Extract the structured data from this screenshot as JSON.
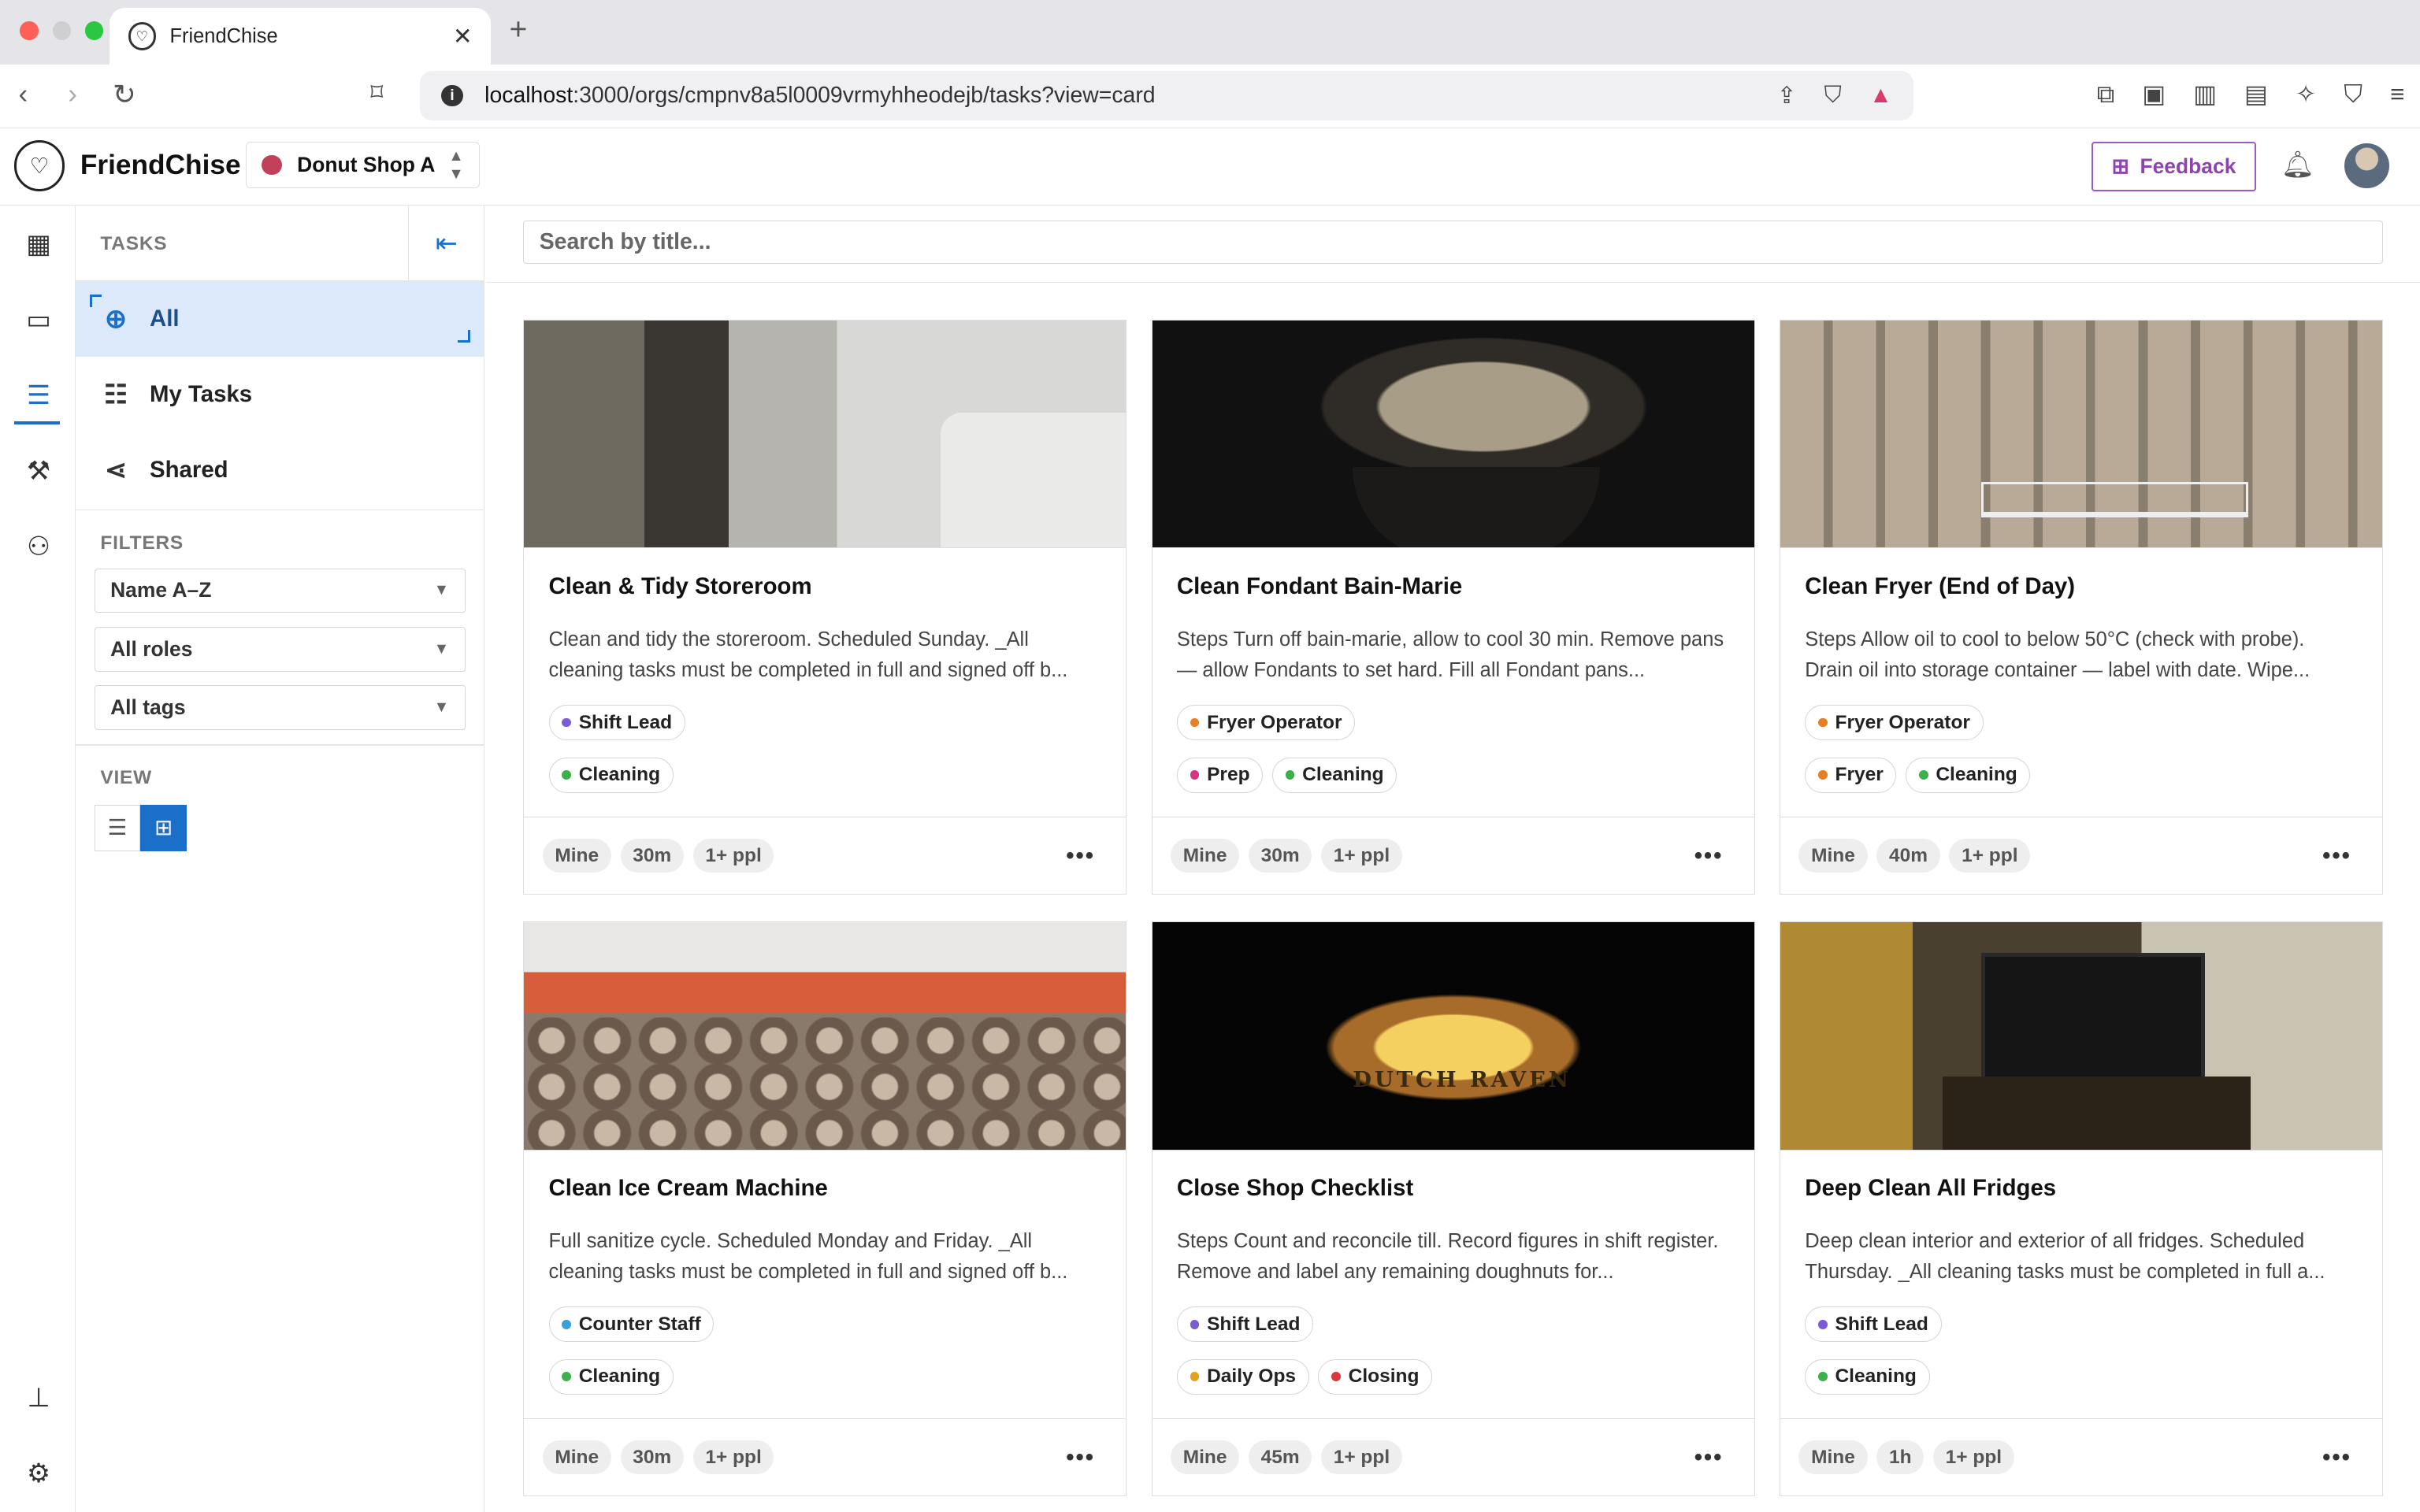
{
  "browser": {
    "tab_title": "FriendChise",
    "url_host": "localhost",
    "url_rest": ":3000/orgs/cmpnv8a5l0009vrmyhheodejb/tasks?view=card"
  },
  "header": {
    "brand": "FriendChise",
    "shop_name": "Donut Shop A",
    "feedback_label": "Feedback"
  },
  "sidebar": {
    "title": "TASKS",
    "nav": [
      {
        "label": "All",
        "icon": "globe-icon"
      },
      {
        "label": "My Tasks",
        "icon": "checklist-icon"
      },
      {
        "label": "Shared",
        "icon": "share-icon"
      }
    ],
    "filters_label": "FILTERS",
    "filters": [
      "Name A–Z",
      "All roles",
      "All tags"
    ],
    "view_label": "VIEW"
  },
  "main": {
    "search_placeholder": "Search by title...",
    "cards": [
      {
        "title": "Clean & Tidy Storeroom",
        "description": "Clean and tidy the storeroom. Scheduled Sunday. _All cleaning tasks must be completed in full and signed off b...",
        "role": {
          "label": "Shift Lead",
          "color": "#7b5cd6"
        },
        "tags": [
          {
            "label": "Cleaning",
            "color": "#3cb04a"
          }
        ],
        "chips": [
          "Mine",
          "30m",
          "1+ ppl"
        ]
      },
      {
        "title": "Clean Fondant Bain-Marie",
        "description": "Steps Turn off bain-marie, allow to cool 30 min. Remove pans — allow Fondants to set hard. Fill all Fondant pans...",
        "role": {
          "label": "Fryer Operator",
          "color": "#e67e22"
        },
        "tags": [
          {
            "label": "Prep",
            "color": "#d63384"
          },
          {
            "label": "Cleaning",
            "color": "#3cb04a"
          }
        ],
        "chips": [
          "Mine",
          "30m",
          "1+ ppl"
        ]
      },
      {
        "title": "Clean Fryer (End of Day)",
        "description": "Steps Allow oil to cool to below 50°C (check with probe). Drain oil into storage container — label with date. Wipe...",
        "role": {
          "label": "Fryer Operator",
          "color": "#e67e22"
        },
        "tags": [
          {
            "label": "Fryer",
            "color": "#e67e22"
          },
          {
            "label": "Cleaning",
            "color": "#3cb04a"
          }
        ],
        "chips": [
          "Mine",
          "40m",
          "1+ ppl"
        ]
      },
      {
        "title": "Clean Ice Cream Machine",
        "description": "Full sanitize cycle. Scheduled Monday and Friday. _All cleaning tasks must be completed in full and signed off b...",
        "role": {
          "label": "Counter Staff",
          "color": "#3aa0d8"
        },
        "tags": [
          {
            "label": "Cleaning",
            "color": "#3cb04a"
          }
        ],
        "chips": [
          "Mine",
          "30m",
          "1+ ppl"
        ]
      },
      {
        "title": "Close Shop Checklist",
        "description": "Steps Count and reconcile till. Record figures in shift register. Remove and label any remaining doughnuts for...",
        "role": {
          "label": "Shift Lead",
          "color": "#7b5cd6"
        },
        "tags": [
          {
            "label": "Daily Ops",
            "color": "#e6a020"
          },
          {
            "label": "Closing",
            "color": "#d9383a"
          }
        ],
        "chips": [
          "Mine",
          "45m",
          "1+ ppl"
        ]
      },
      {
        "title": "Deep Clean All Fridges",
        "description": "Deep clean interior and exterior of all fridges. Scheduled Thursday. _All cleaning tasks must be completed in full a...",
        "role": {
          "label": "Shift Lead",
          "color": "#7b5cd6"
        },
        "tags": [
          {
            "label": "Cleaning",
            "color": "#3cb04a"
          }
        ],
        "chips": [
          "Mine",
          "1h",
          "1+ ppl"
        ]
      }
    ]
  }
}
